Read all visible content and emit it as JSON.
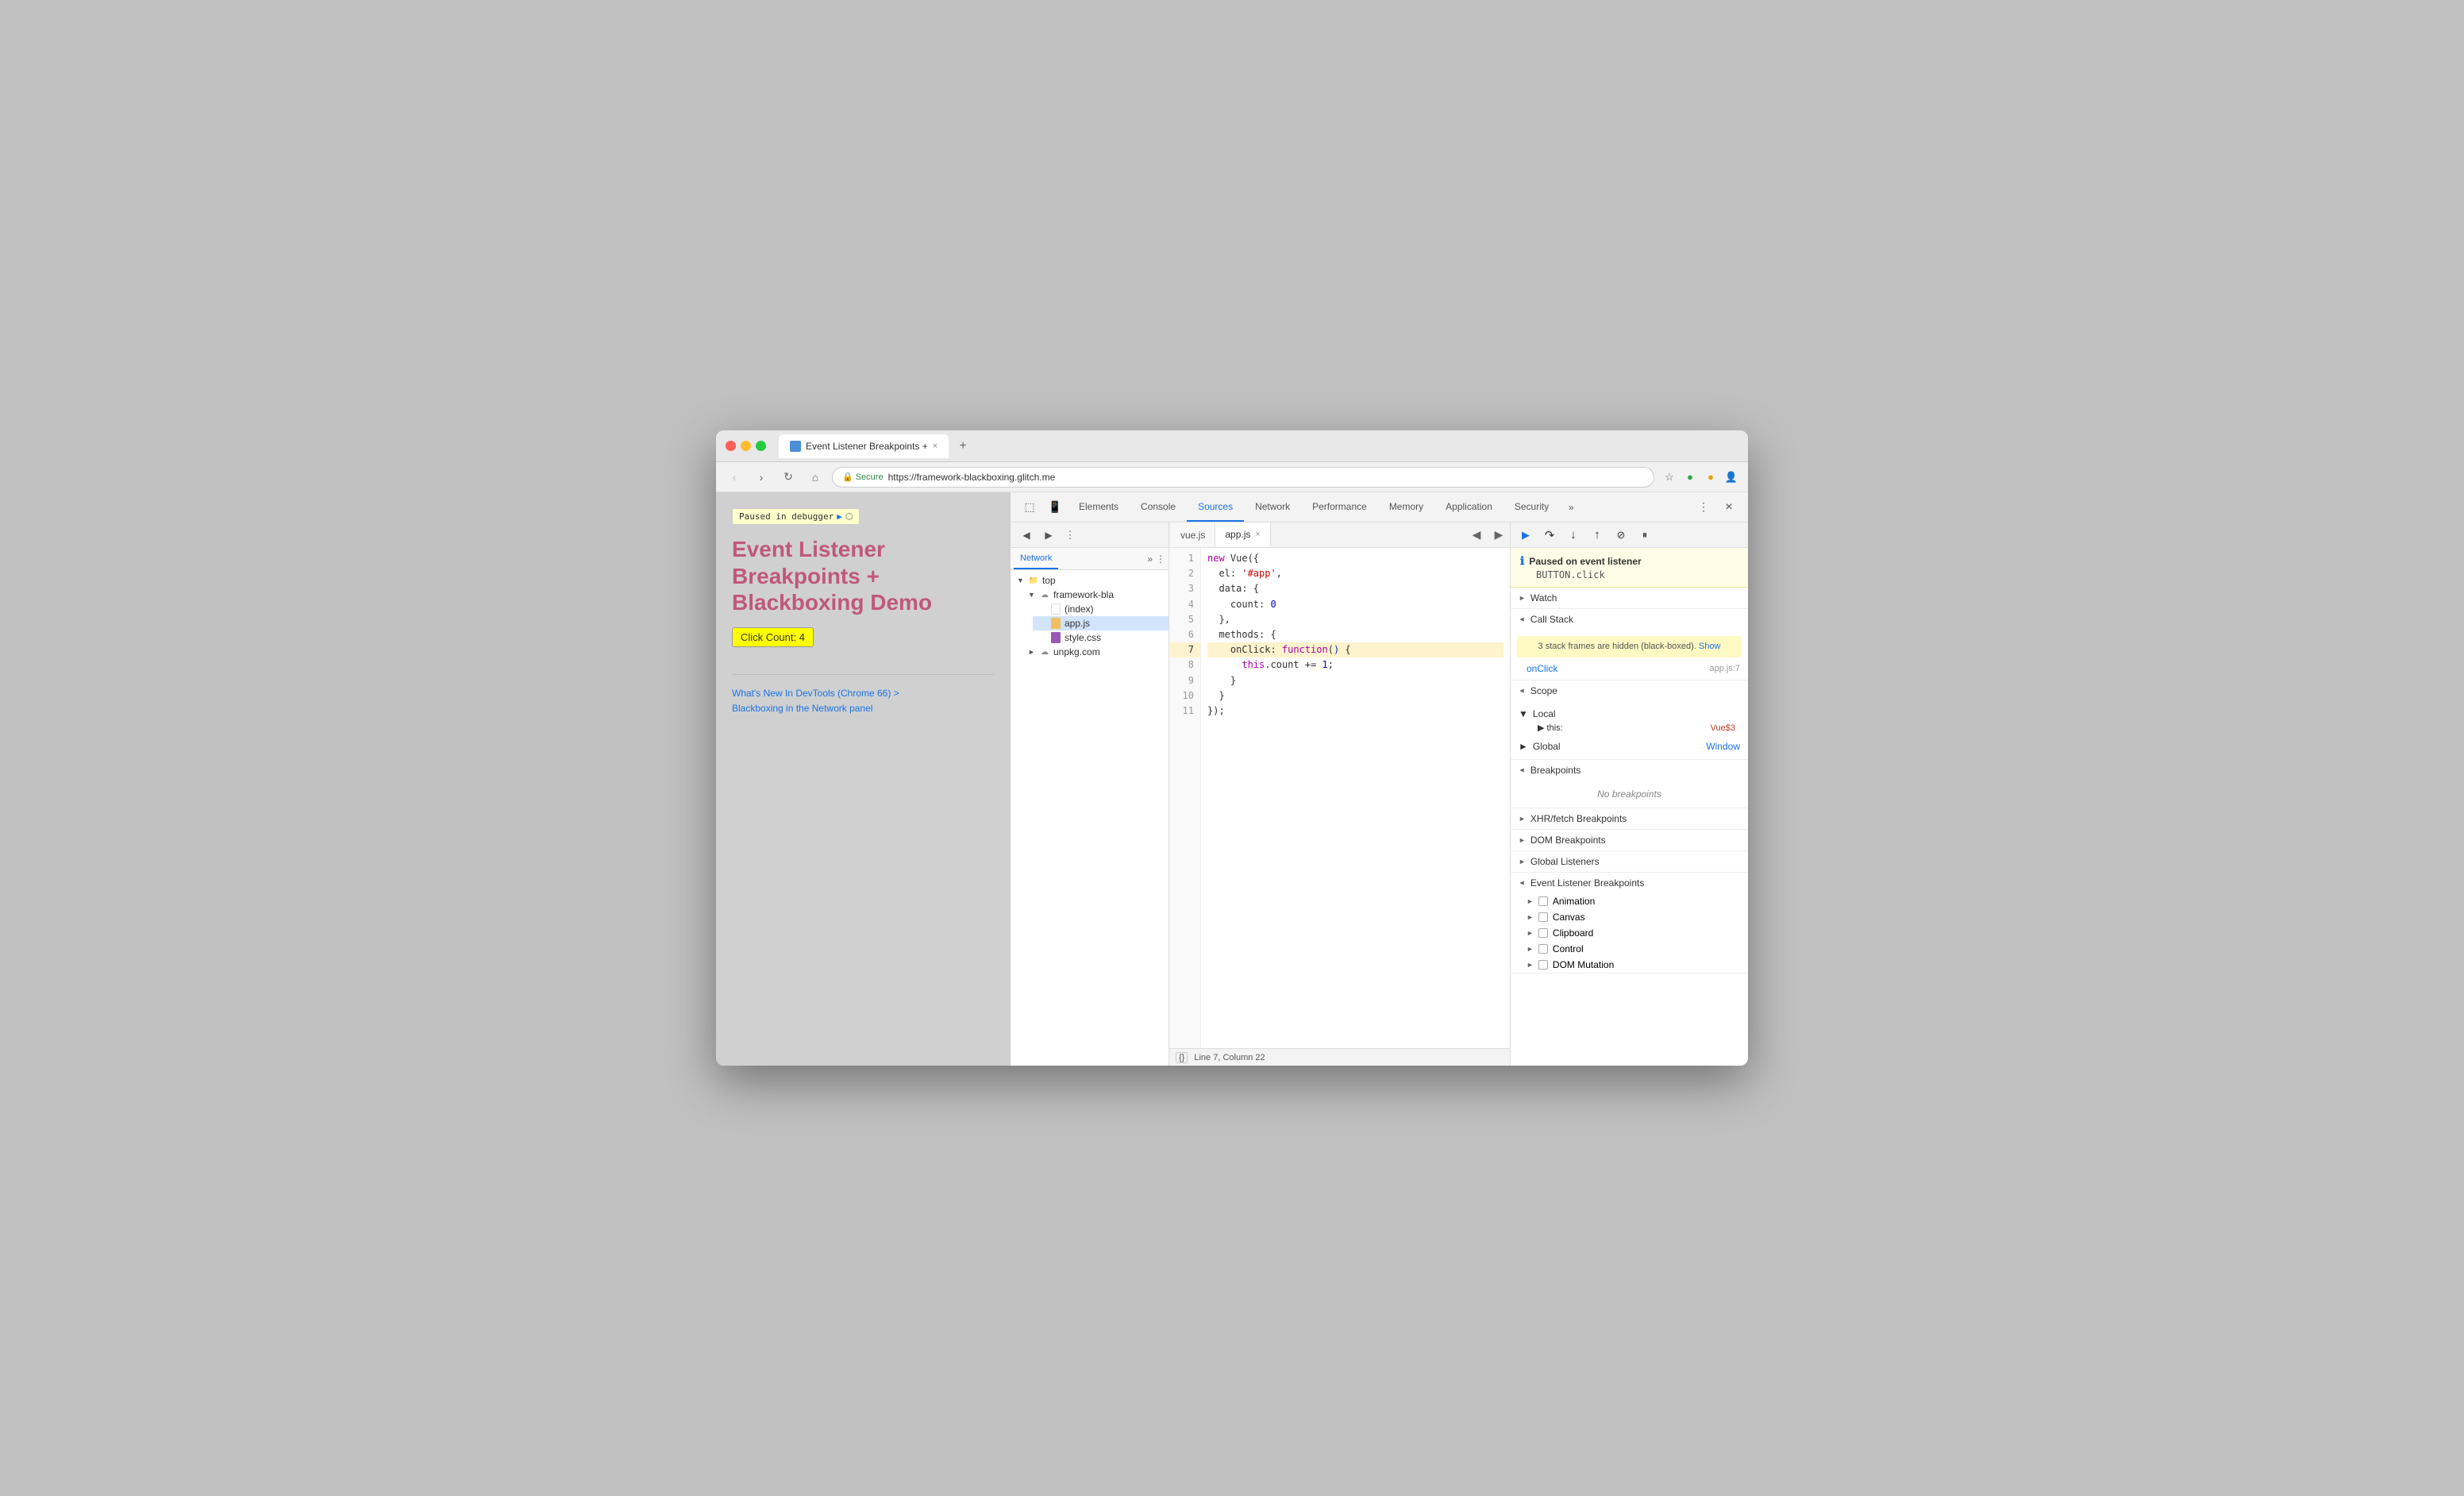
{
  "titleBar": {
    "tabTitle": "Event Listener Breakpoints +",
    "closeLabel": "×"
  },
  "addressBar": {
    "protocol": "Secure",
    "url": "https://framework-blackboxing.glitch.me",
    "backBtn": "‹",
    "forwardBtn": "›",
    "refreshBtn": "↻"
  },
  "webpage": {
    "pausedBadge": "Paused in debugger",
    "title": "Event Listener Breakpoints + Blackboxing Demo",
    "clickCount": "Click Count: 4",
    "link1": "What's New In DevTools (Chrome 66) >",
    "link2": "Blackboxing in the Network panel"
  },
  "devtools": {
    "tabs": [
      "Elements",
      "Console",
      "Sources",
      "Network",
      "Performance",
      "Memory",
      "Application",
      "Security"
    ],
    "activeTab": "Sources",
    "moreLabel": "»",
    "menuLabel": "⋮",
    "closeLabel": "×"
  },
  "fileTree": {
    "tabs": [
      "Network",
      "»",
      "⋮"
    ],
    "activeTab": "Network",
    "items": [
      {
        "level": 0,
        "arrow": "▼",
        "icon": "folder",
        "label": "top"
      },
      {
        "level": 1,
        "arrow": "▼",
        "icon": "cloud",
        "label": "framework-bla"
      },
      {
        "level": 2,
        "arrow": "",
        "icon": "file-white",
        "label": "(index)"
      },
      {
        "level": 2,
        "arrow": "",
        "icon": "file-yellow",
        "label": "app.js"
      },
      {
        "level": 2,
        "arrow": "",
        "icon": "file-purple",
        "label": "style.css"
      },
      {
        "level": 1,
        "arrow": "►",
        "icon": "cloud",
        "label": "unpkg.com"
      }
    ]
  },
  "codeEditor": {
    "tabs": [
      "vue.js",
      "app.js"
    ],
    "activeTab": "app.js",
    "lines": [
      {
        "num": 1,
        "code": "new Vue({",
        "highlight": false
      },
      {
        "num": 2,
        "code": "  el: '#app',",
        "highlight": false
      },
      {
        "num": 3,
        "code": "  data: {",
        "highlight": false
      },
      {
        "num": 4,
        "code": "    count: 0",
        "highlight": false
      },
      {
        "num": 5,
        "code": "  },",
        "highlight": false
      },
      {
        "num": 6,
        "code": "  methods: {",
        "highlight": false
      },
      {
        "num": 7,
        "code": "    onClick: function() {",
        "highlight": true
      },
      {
        "num": 8,
        "code": "      this.count += 1;",
        "highlight": false
      },
      {
        "num": 9,
        "code": "    }",
        "highlight": false
      },
      {
        "num": 10,
        "code": "  }",
        "highlight": false
      },
      {
        "num": 11,
        "code": "});",
        "highlight": false
      }
    ],
    "statusBar": "Line 7, Column 22",
    "prettyPrintLabel": "{}"
  },
  "debugger": {
    "pausedTitle": "Paused on event listener",
    "pausedDetail": "BUTTON.click",
    "sections": {
      "watch": {
        "label": "Watch",
        "open": false
      },
      "callStack": {
        "label": "Call Stack",
        "open": true,
        "note": "3 stack frames are hidden (black-boxed).",
        "showLabel": "Show",
        "items": [
          {
            "name": "onClick",
            "loc": "app.js:7"
          }
        ]
      },
      "scope": {
        "label": "Scope",
        "open": true,
        "local": {
          "label": "Local",
          "items": [
            {
              "key": "▶ this:",
              "val": "Vue$3"
            }
          ]
        },
        "global": {
          "label": "Global",
          "val": "Window"
        }
      },
      "breakpoints": {
        "label": "Breakpoints",
        "open": true,
        "emptyText": "No breakpoints"
      },
      "xhrBreakpoints": {
        "label": "XHR/fetch Breakpoints",
        "open": false
      },
      "domBreakpoints": {
        "label": "DOM Breakpoints",
        "open": false
      },
      "globalListeners": {
        "label": "Global Listeners",
        "open": false
      },
      "eventListenerBreakpoints": {
        "label": "Event Listener Breakpoints",
        "open": true,
        "items": [
          {
            "label": "Animation"
          },
          {
            "label": "Canvas"
          },
          {
            "label": "Clipboard"
          },
          {
            "label": "Control"
          },
          {
            "label": "DOM Mutation"
          }
        ]
      }
    },
    "toolbar": {
      "resume": "▶",
      "stepOver": "↷",
      "stepInto": "↓",
      "stepOut": "↑",
      "deactivate": "⊘",
      "pause": "⏸"
    }
  }
}
